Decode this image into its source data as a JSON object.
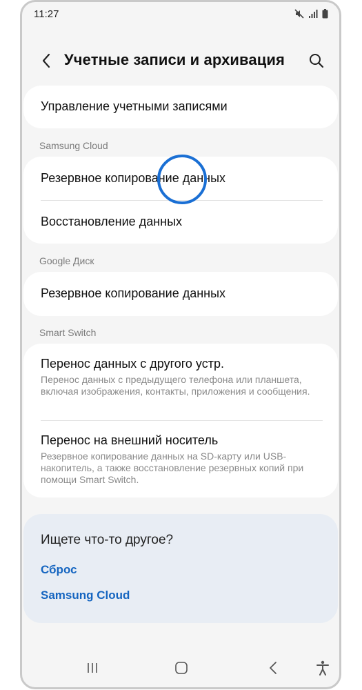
{
  "status": {
    "time": "11:27"
  },
  "header": {
    "title": "Учетные записи и архивация"
  },
  "manage": {
    "label": "Управление учетными записями"
  },
  "samsung_cloud": {
    "section": "Samsung Cloud",
    "items": [
      {
        "label": "Резервное копирование данных"
      },
      {
        "label": "Восстановление данных"
      }
    ]
  },
  "google_drive": {
    "section": "Google Диск",
    "items": [
      {
        "label": "Резервное копирование данных"
      }
    ]
  },
  "smart_switch": {
    "section": "Smart Switch",
    "items": [
      {
        "label": "Перенос данных с другого устр.",
        "sub": "Перенос данных с предыдущего телефона или планшета, включая изображения, контакты, приложения и сообщения."
      },
      {
        "label": "Перенос на внешний носитель",
        "sub": "Резервное копирование данных на SD-карту или USB-накопитель, а также восстановление резервных копий при помощи Smart Switch."
      }
    ]
  },
  "suggestions": {
    "title": "Ищете что-то другое?",
    "links": [
      {
        "label": "Сброс"
      },
      {
        "label": "Samsung Cloud"
      }
    ]
  },
  "colors": {
    "accent": "#1565c0",
    "touch": "#1a6fd4",
    "background": "#f5f5f5"
  },
  "icons": {
    "status": [
      "mute-icon",
      "signal-icon",
      "battery-icon"
    ],
    "header": [
      "back-arrow-icon",
      "search-icon"
    ],
    "nav": [
      "recents-icon",
      "home-icon",
      "back-icon",
      "accessibility-icon"
    ]
  }
}
